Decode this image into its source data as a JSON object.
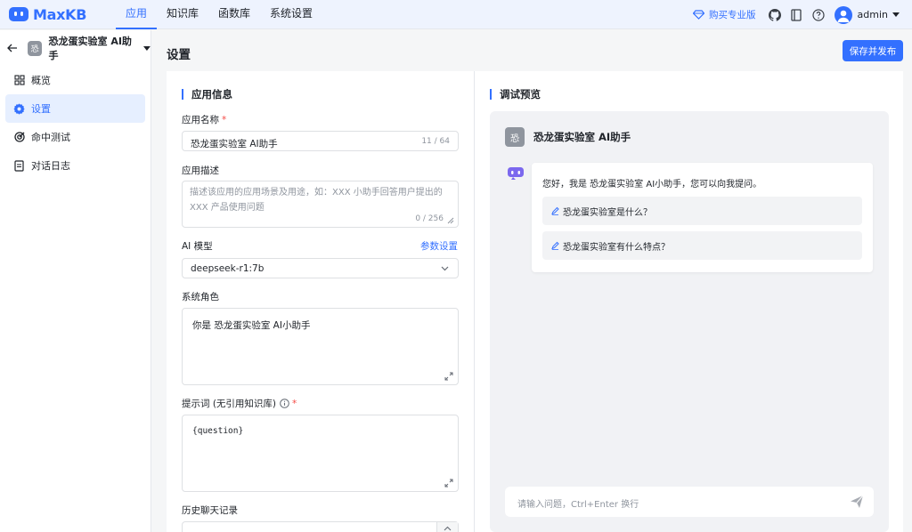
{
  "app": {
    "logo_text": "MaxKB",
    "nav": [
      "应用",
      "知识库",
      "函数库",
      "系统设置"
    ],
    "active_nav": 0,
    "buy_label": "购买专业版",
    "username": "admin",
    "accent": "#3370ff"
  },
  "sidebar": {
    "app_badge": "恐",
    "app_name": "恐龙蛋实验室 AI助手",
    "items": [
      {
        "label": "概览",
        "icon": "grid-icon"
      },
      {
        "label": "设置",
        "icon": "gear-icon"
      },
      {
        "label": "命中测试",
        "icon": "target-icon"
      },
      {
        "label": "对话日志",
        "icon": "document-icon"
      }
    ],
    "active": 1
  },
  "page": {
    "title": "设置",
    "publish_label": "保存并发布"
  },
  "form": {
    "section_title": "应用信息",
    "name_label": "应用名称",
    "required_mark": "*",
    "name_value": "恐龙蛋实验室 AI助手",
    "name_count": "11 / 64",
    "desc_label": "应用描述",
    "desc_placeholder": "描述该应用的应用场景及用途，如：XXX 小助手回答用户提出的 XXX 产品使用问题",
    "desc_count": "0 / 256",
    "model_label": "AI 模型",
    "model_link": "参数设置",
    "model_value": "deepseek-r1:7b",
    "role_label": "系统角色",
    "role_value": "你是 恐龙蛋实验室 AI小助手",
    "prompt_label": "提示词 (无引用知识库)",
    "prompt_value": "{question}",
    "history_label": "历史聊天记录"
  },
  "preview": {
    "section_title": "调试预览",
    "app_badge": "恐",
    "app_name": "恐龙蛋实验室 AI助手",
    "greeting": "您好，我是 恐龙蛋实验室 AI小助手，您可以向我提问。",
    "questions": [
      "恐龙蛋实验室是什么？",
      "恐龙蛋实验室有什么特点？"
    ],
    "input_placeholder": "请输入问题，Ctrl+Enter 换行"
  }
}
